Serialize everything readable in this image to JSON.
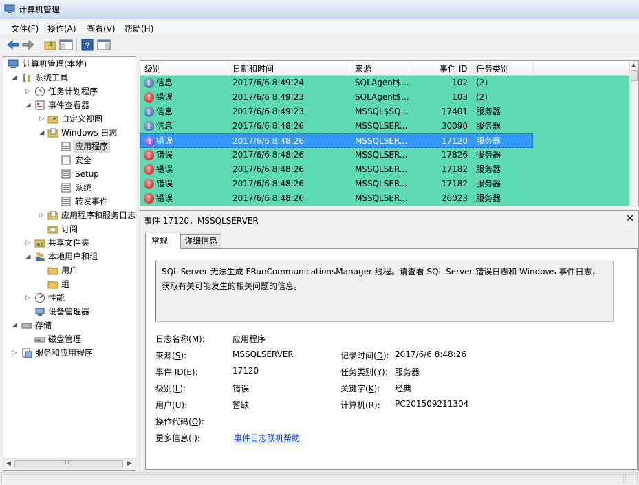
{
  "window": {
    "title": "计算机管理"
  },
  "menu": [
    {
      "label": "文件(F)"
    },
    {
      "label": "操作(A)"
    },
    {
      "label": "查看(V)"
    },
    {
      "label": "帮助(H)"
    }
  ],
  "toolbar": {
    "buttons": [
      "back-arrow-icon",
      "forward-arrow-icon",
      "up-folder-icon",
      "show-hide-tree-icon",
      "help-icon",
      "action-pane-icon"
    ]
  },
  "tree": {
    "root": "计算机管理(本地)",
    "system_tools": "系统工具",
    "task_scheduler": "任务计划程序",
    "event_viewer": "事件查看器",
    "custom_views": "自定义视图",
    "windows_logs": "Windows 日志",
    "application": "应用程序",
    "security": "安全",
    "setup": "Setup",
    "system": "系统",
    "forwarded": "转发事件",
    "app_service_logs": "应用程序和服务日志",
    "subscriptions": "订阅",
    "shared_folders": "共享文件夹",
    "local_users": "本地用户和组",
    "users": "用户",
    "groups": "组",
    "performance": "性能",
    "device_manager": "设备管理器",
    "storage": "存储",
    "disk_management": "磁盘管理",
    "services_apps": "服务和应用程序",
    "scroll_grip": "III"
  },
  "event_list": {
    "columns": [
      "级别",
      "日期和时间",
      "来源",
      "事件 ID",
      "任务类别"
    ],
    "rows": [
      {
        "level": "信息",
        "icon": "info",
        "datetime": "2017/6/6 8:49:24",
        "source": "SQLAgent$...",
        "id": "102",
        "category": "(2)"
      },
      {
        "level": "错误",
        "icon": "error",
        "datetime": "2017/6/6 8:49:23",
        "source": "SQLAgent$...",
        "id": "103",
        "category": "(2)"
      },
      {
        "level": "信息",
        "icon": "info",
        "datetime": "2017/6/6 8:49:23",
        "source": "MSSQL$SQ...",
        "id": "17401",
        "category": "服务器"
      },
      {
        "level": "信息",
        "icon": "info",
        "datetime": "2017/6/6 8:48:26",
        "source": "MSSQLSER...",
        "id": "30090",
        "category": "服务器"
      },
      {
        "level": "错误",
        "icon": "error",
        "datetime": "2017/6/6 8:48:26",
        "source": "MSSQLSER...",
        "id": "17120",
        "category": "服务器",
        "selected": true
      },
      {
        "level": "错误",
        "icon": "error",
        "datetime": "2017/6/6 8:48:26",
        "source": "MSSQLSER...",
        "id": "17826",
        "category": "服务器"
      },
      {
        "level": "错误",
        "icon": "error",
        "datetime": "2017/6/6 8:48:26",
        "source": "MSSQLSER...",
        "id": "17182",
        "category": "服务器"
      },
      {
        "level": "错误",
        "icon": "error",
        "datetime": "2017/6/6 8:48:26",
        "source": "MSSQLSER...",
        "id": "17182",
        "category": "服务器"
      },
      {
        "level": "错误",
        "icon": "error",
        "datetime": "2017/6/6 8:48:26",
        "source": "MSSQLSER...",
        "id": "26023",
        "category": "服务器"
      }
    ]
  },
  "details": {
    "title": "事件 17120，MSSQLSERVER",
    "tabs": {
      "general": "常规",
      "details": "详细信息"
    },
    "description": "SQL Server 无法生成 FRunCommunicationsManager 线程。请查看 SQL Server 错误日志和 Windows 事件日志，获取有关可能发生的相关问题的信息。",
    "fields": {
      "log_name_label": "日志名称(",
      "log_name_key": "M",
      "log_name_value": "应用程序",
      "source_label": "来源(",
      "source_key": "S",
      "source_value": "MSSQLSERVER",
      "logged_label": "记录时间(",
      "logged_key": "D",
      "logged_value": "2017/6/6 8:48:26",
      "event_id_label": "事件 ID(",
      "event_id_key": "E",
      "event_id_value": "17120",
      "task_cat_label": "任务类别(",
      "task_cat_key": "Y",
      "task_cat_value": "服务器",
      "level_label": "级别(",
      "level_key": "L",
      "level_value": "错误",
      "keywords_label": "关键字(",
      "keywords_key": "K",
      "keywords_value": "经典",
      "user_label": "用户(",
      "user_key": "U",
      "user_value": "暂缺",
      "computer_label": "计算机(",
      "computer_key": "R",
      "computer_value": "PC201509211304",
      "opcode_label": "操作代码(",
      "opcode_key": "O",
      "more_info_label": "更多信息(",
      "more_info_key": "I",
      "more_info_link": "事件日志联机帮助",
      "suffix": "):"
    }
  },
  "colors": {
    "list_bg": "#5dd9b3",
    "selection": "#3399ff",
    "link": "#0033cc"
  }
}
